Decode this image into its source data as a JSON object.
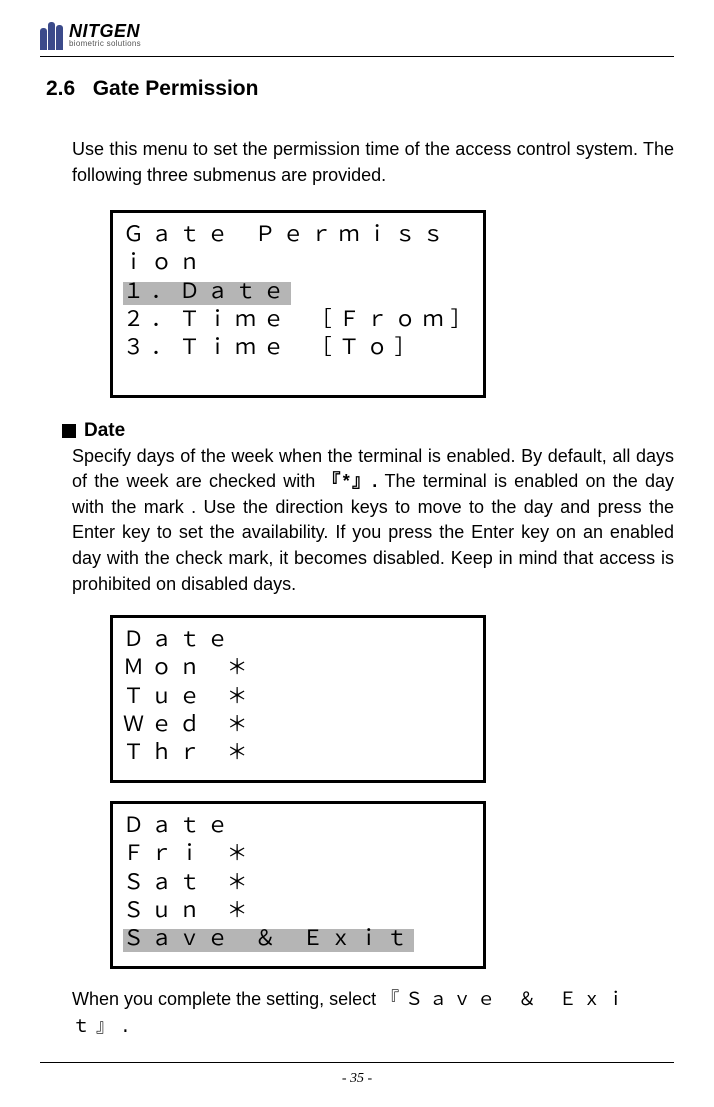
{
  "brand": {
    "name": "NITGEN",
    "tagline": "biometric solutions"
  },
  "section": {
    "number": "2.6",
    "title": "Gate Permission"
  },
  "intro": "Use this menu to set the permission time of the access control system. The following three submenus are provided.",
  "lcd1": {
    "title": "Ｇａｔｅ Ｐｅｒｍｉｓｓｉｏｎ",
    "item1": "１．Ｄａｔｅ",
    "item2": "２．Ｔｉｍｅ  ［Ｆｒｏｍ］",
    "item3": "３．Ｔｉｍｅ  ［Ｔｏ］"
  },
  "date": {
    "heading": "Date",
    "para_a": "Specify days of the week when the terminal is enabled. By default, all days of the week are checked with ",
    "mark": "『*』.",
    "para_b": " The terminal is enabled on the day with the mark . Use the direction keys to move to the day and press the Enter key to set the availability. If you press the Enter key on an enabled day with the check mark, it becomes disabled. Keep in mind that access is prohibited on disabled days."
  },
  "lcd2": {
    "r1": "Ｄａｔｅ",
    "r2": "Ｍｏｎ  ＊",
    "r3": "Ｔｕｅ  ＊",
    "r4": "Ｗｅｄ  ＊",
    "r5": "Ｔｈｒ  ＊"
  },
  "lcd3": {
    "r1": "Ｄａｔｅ",
    "r2": "Ｆｒｉ  ＊",
    "r3": "Ｓａｔ  ＊",
    "r4": "Ｓｕｎ  ＊",
    "r5": "Ｓａｖｅ ＆  Ｅｘｉｔ"
  },
  "closing": {
    "a": "When you complete the setting, select  ",
    "b": "『Ｓａｖｅ  ＆  Ｅｘｉｔ』."
  },
  "page": "- 35 -"
}
